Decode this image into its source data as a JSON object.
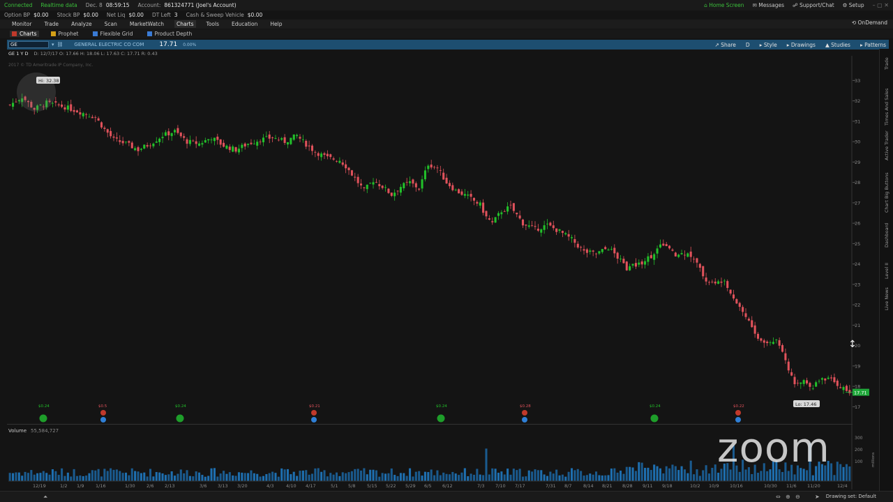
{
  "status": {
    "connected": "Connected",
    "realtime": "Realtime data",
    "date_label": "Dec. 8",
    "time": "08:59:15",
    "account_label": "Account:",
    "account": "861324771 (Joel's Account)",
    "option_bp_label": "Option BP",
    "option_bp": "$0.00",
    "stock_bp_label": "Stock BP",
    "stock_bp": "$0.00",
    "net_liq_label": "Net Liq",
    "net_liq": "$0.00",
    "dt_left_label": "DT Left",
    "dt_left": "3",
    "cash_label": "Cash & Sweep Vehicle",
    "cash": "$0.00",
    "home_screen": "Home Screen",
    "messages": "Messages",
    "support": "Support/Chat",
    "setup": "Setup"
  },
  "menu": [
    "Monitor",
    "Trade",
    "Analyze",
    "Scan",
    "MarketWatch",
    "Charts",
    "Tools",
    "Education",
    "Help"
  ],
  "active_menu": "Charts",
  "ondemand": "OnDemand",
  "subtabs": [
    {
      "label": "Charts",
      "color": "#c0392b"
    },
    {
      "label": "Prophet",
      "color": "#d4a017"
    },
    {
      "label": "Flexible Grid",
      "color": "#3a7bd5"
    },
    {
      "label": "Product Depth",
      "color": "#3a7bd5"
    }
  ],
  "chart_header": {
    "symbol": "GE",
    "company": "GENERAL ELECTRIC CO COM",
    "last": "17.71",
    "change": "0.00%",
    "tools": [
      "Share",
      "D",
      "Style",
      "Drawings",
      "Studies",
      "Patterns"
    ]
  },
  "ohlc": {
    "timeframe": "GE 1 Y D",
    "values": "D: 12/7/17   O: 17.66   H: 18.06   L: 17.63   C: 17.71   R: 0.43"
  },
  "copyright": "2017 © TD Ameritrade IP Company, Inc.",
  "volume": {
    "label": "Volume",
    "value": "55,584,727"
  },
  "right_rail_tabs": [
    "Trade",
    "Times And Sales",
    "Active Trader",
    "Big Buttons",
    "Chart",
    "Dashboard",
    "Level II",
    "Live News"
  ],
  "drawing_set": "Drawing set: Default",
  "watermark": "zoom",
  "colors": {
    "up": "#22c02a",
    "down": "#e0525b",
    "header": "#1d4e70",
    "price_tag": "#1fa83a"
  },
  "chart_data": {
    "type": "candlestick",
    "symbol": "GE",
    "price_ylim": [
      16.5,
      33.8
    ],
    "price_ticks": [
      17,
      18,
      19,
      20,
      21,
      22,
      23,
      24,
      25,
      26,
      27,
      28,
      29,
      30,
      31,
      32,
      33
    ],
    "x_labels": [
      "12/19",
      "1/2",
      "1/9",
      "1/16",
      "1/30",
      "2/6",
      "2/13",
      "3/6",
      "3/13",
      "3/20",
      "4/3",
      "4/10",
      "4/17",
      "5/1",
      "5/8",
      "5/15",
      "5/22",
      "5/29",
      "6/5",
      "6/12",
      "7/3",
      "7/10",
      "7/17",
      "7/31",
      "8/7",
      "8/14",
      "8/21",
      "8/28",
      "9/11",
      "9/18",
      "10/2",
      "10/9",
      "10/16",
      "10/30",
      "11/6",
      "11/20",
      "12/4"
    ],
    "high_label": "Hi: 32.38",
    "low_label": "Lo: 17.46",
    "last_price_label": "17.71",
    "close_path": [
      [
        0,
        31.8
      ],
      [
        4,
        32.2
      ],
      [
        8,
        31.6
      ],
      [
        12,
        31.9
      ],
      [
        18,
        31.7
      ],
      [
        24,
        31.4
      ],
      [
        28,
        31.2
      ],
      [
        31,
        30.6
      ],
      [
        34,
        30.1
      ],
      [
        38,
        29.9
      ],
      [
        42,
        29.6
      ],
      [
        46,
        29.9
      ],
      [
        50,
        30.3
      ],
      [
        54,
        30.5
      ],
      [
        58,
        30.0
      ],
      [
        62,
        29.9
      ],
      [
        66,
        30.2
      ],
      [
        70,
        29.8
      ],
      [
        74,
        29.6
      ],
      [
        78,
        29.9
      ],
      [
        82,
        30.1
      ],
      [
        86,
        30.2
      ],
      [
        90,
        30.0
      ],
      [
        94,
        30.3
      ],
      [
        96,
        30.0
      ],
      [
        100,
        29.5
      ],
      [
        104,
        29.2
      ],
      [
        108,
        29.1
      ],
      [
        110,
        28.8
      ],
      [
        113,
        28.2
      ],
      [
        116,
        27.6
      ],
      [
        119,
        28.1
      ],
      [
        122,
        27.8
      ],
      [
        125,
        27.4
      ],
      [
        128,
        27.8
      ],
      [
        131,
        28.0
      ],
      [
        134,
        27.7
      ],
      [
        137,
        28.9
      ],
      [
        140,
        28.7
      ],
      [
        143,
        28.0
      ],
      [
        146,
        27.6
      ],
      [
        150,
        27.3
      ],
      [
        154,
        26.9
      ],
      [
        156,
        26.3
      ],
      [
        158,
        26.0
      ],
      [
        161,
        26.6
      ],
      [
        164,
        26.8
      ],
      [
        168,
        26.0
      ],
      [
        172,
        25.7
      ],
      [
        176,
        25.9
      ],
      [
        180,
        25.6
      ],
      [
        184,
        25.2
      ],
      [
        188,
        24.6
      ],
      [
        192,
        24.5
      ],
      [
        196,
        24.8
      ],
      [
        198,
        24.5
      ],
      [
        202,
        23.8
      ],
      [
        206,
        24.0
      ],
      [
        210,
        24.4
      ],
      [
        214,
        25.0
      ],
      [
        218,
        24.4
      ],
      [
        222,
        24.6
      ],
      [
        225,
        24.0
      ],
      [
        228,
        23.2
      ],
      [
        231,
        23.0
      ],
      [
        234,
        23.3
      ],
      [
        236,
        22.6
      ],
      [
        239,
        21.9
      ],
      [
        242,
        21.2
      ],
      [
        245,
        20.3
      ],
      [
        248,
        20.1
      ],
      [
        251,
        20.3
      ],
      [
        253,
        19.8
      ],
      [
        255,
        18.9
      ],
      [
        257,
        18.0
      ],
      [
        260,
        18.3
      ],
      [
        263,
        18.0
      ],
      [
        266,
        18.4
      ],
      [
        269,
        18.3
      ],
      [
        272,
        18.0
      ],
      [
        275,
        17.7
      ]
    ],
    "dividends": [
      {
        "label": "$0.24",
        "kind": "dividend"
      },
      {
        "label": "$0.5",
        "kind": "earnings"
      },
      {
        "label": "$0.24",
        "kind": "dividend"
      },
      {
        "label": "$0.21",
        "kind": "earnings"
      },
      {
        "label": "$0.24",
        "kind": "dividend"
      },
      {
        "label": "$0.28",
        "kind": "earnings"
      },
      {
        "label": "$0.24",
        "kind": "dividend"
      },
      {
        "label": "$0.22",
        "kind": "earnings"
      }
    ],
    "volume_ticks": [
      "300",
      "200",
      "100"
    ],
    "volume_unit": "millions",
    "bars": 276
  }
}
